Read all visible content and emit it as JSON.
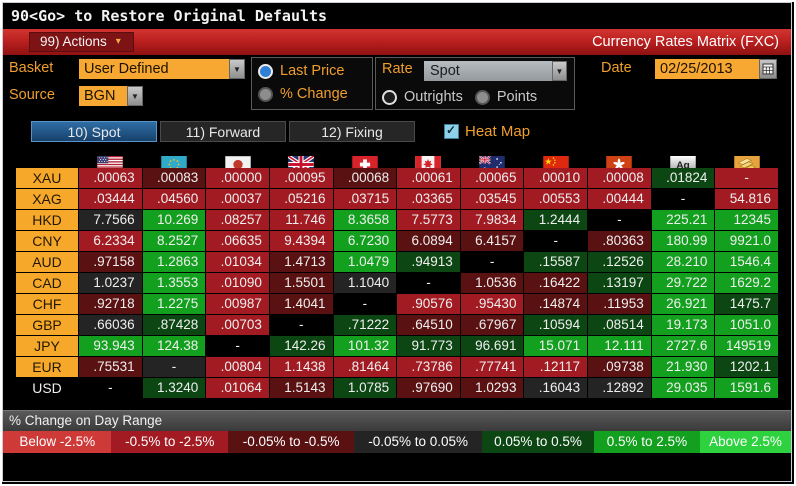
{
  "titlebar": {
    "text": "90<Go> to Restore Original Defaults"
  },
  "menubar": {
    "actions_label": "99) Actions",
    "actions_arrow_icon": "▾",
    "title": "Currency Rates Matrix (FXC)"
  },
  "controls": {
    "basket_label": "Basket",
    "basket_value": "User Defined",
    "source_label": "Source",
    "source_value": "BGN",
    "price_options": [
      {
        "label": "Last Price",
        "selected": true
      },
      {
        "label": "% Change",
        "selected": false
      }
    ],
    "rate_label": "Rate",
    "rate_value": "Spot",
    "outright_options": [
      {
        "label": "Outrights",
        "selected": true
      },
      {
        "label": "Points",
        "selected": false
      }
    ],
    "date_label": "Date",
    "date_value": "02/25/2013",
    "calendar_icon": "calendar-grid",
    "dropdown_arrow_icon": "▼"
  },
  "tabs": [
    {
      "label": "10) Spot",
      "selected": true
    },
    {
      "label": "11) Forward",
      "selected": false
    },
    {
      "label": "12) Fixing",
      "selected": false
    }
  ],
  "heatmap": {
    "label": "Heat Map",
    "checked": true
  },
  "heat_colors": {
    "bk": "#000000",
    "n": "#242424",
    "r": "#a21b22",
    "dr": "#5a1112",
    "dg": "#0c4613",
    "g": "#13a01e",
    "br": "#cd3a38",
    "bg": "#2ed13e"
  },
  "matrix": {
    "columns": [
      {
        "code": "USD",
        "flag": "us-flag"
      },
      {
        "code": "EUR",
        "flag": "eu-flag"
      },
      {
        "code": "JPY",
        "flag": "jp-flag"
      },
      {
        "code": "GBP",
        "flag": "uk-flag"
      },
      {
        "code": "CHF",
        "flag": "ch-flag"
      },
      {
        "code": "CAD",
        "flag": "ca-flag"
      },
      {
        "code": "AUD",
        "flag": "au-flag"
      },
      {
        "code": "CNY",
        "flag": "cn-flag"
      },
      {
        "code": "HKD",
        "flag": "hk-flag"
      },
      {
        "code": "XAG",
        "flag": "silver-icon"
      },
      {
        "code": "XAU",
        "flag": "gold-icon"
      }
    ],
    "rows": [
      {
        "label": "XAU",
        "label_style": "orange",
        "cells": [
          {
            "v": ".00063",
            "c": "r"
          },
          {
            "v": ".00083",
            "c": "dr"
          },
          {
            "v": ".00000",
            "c": "r"
          },
          {
            "v": ".00095",
            "c": "r"
          },
          {
            "v": ".00068",
            "c": "dr"
          },
          {
            "v": ".00061",
            "c": "r"
          },
          {
            "v": ".00065",
            "c": "r"
          },
          {
            "v": ".00010",
            "c": "r"
          },
          {
            "v": ".00008",
            "c": "r"
          },
          {
            "v": ".01824",
            "c": "dg"
          },
          {
            "v": "-",
            "c": "r"
          }
        ]
      },
      {
        "label": "XAG",
        "label_style": "orange",
        "cells": [
          {
            "v": ".03444",
            "c": "r"
          },
          {
            "v": ".04560",
            "c": "r"
          },
          {
            "v": ".00037",
            "c": "r"
          },
          {
            "v": ".05216",
            "c": "r"
          },
          {
            "v": ".03715",
            "c": "r"
          },
          {
            "v": ".03365",
            "c": "r"
          },
          {
            "v": ".03545",
            "c": "r"
          },
          {
            "v": ".00553",
            "c": "r"
          },
          {
            "v": ".00444",
            "c": "r"
          },
          {
            "v": "-",
            "c": "bk"
          },
          {
            "v": "54.816",
            "c": "r"
          }
        ]
      },
      {
        "label": "HKD",
        "label_style": "orange",
        "cells": [
          {
            "v": "7.7566",
            "c": "n"
          },
          {
            "v": "10.269",
            "c": "g"
          },
          {
            "v": ".08257",
            "c": "r"
          },
          {
            "v": "11.746",
            "c": "r"
          },
          {
            "v": "8.3658",
            "c": "g"
          },
          {
            "v": "7.5773",
            "c": "r"
          },
          {
            "v": "7.9834",
            "c": "r"
          },
          {
            "v": "1.2444",
            "c": "dg"
          },
          {
            "v": "-",
            "c": "bk"
          },
          {
            "v": "225.21",
            "c": "g"
          },
          {
            "v": "12345",
            "c": "g"
          }
        ]
      },
      {
        "label": "CNY",
        "label_style": "orange",
        "cells": [
          {
            "v": "6.2334",
            "c": "r"
          },
          {
            "v": "8.2527",
            "c": "g"
          },
          {
            "v": ".06635",
            "c": "r"
          },
          {
            "v": "9.4394",
            "c": "r"
          },
          {
            "v": "6.7230",
            "c": "g"
          },
          {
            "v": "6.0894",
            "c": "dr"
          },
          {
            "v": "6.4157",
            "c": "dr"
          },
          {
            "v": "-",
            "c": "bk"
          },
          {
            "v": ".80363",
            "c": "dr"
          },
          {
            "v": "180.99",
            "c": "g"
          },
          {
            "v": "9921.0",
            "c": "g"
          }
        ]
      },
      {
        "label": "AUD",
        "label_style": "orange",
        "cells": [
          {
            "v": ".97158",
            "c": "dr"
          },
          {
            "v": "1.2863",
            "c": "g"
          },
          {
            "v": ".01034",
            "c": "r"
          },
          {
            "v": "1.4713",
            "c": "dr"
          },
          {
            "v": "1.0479",
            "c": "g"
          },
          {
            "v": ".94913",
            "c": "dg"
          },
          {
            "v": "-",
            "c": "bk"
          },
          {
            "v": ".15587",
            "c": "dg"
          },
          {
            "v": ".12526",
            "c": "dg"
          },
          {
            "v": "28.210",
            "c": "g"
          },
          {
            "v": "1546.4",
            "c": "g"
          }
        ]
      },
      {
        "label": "CAD",
        "label_style": "orange",
        "cells": [
          {
            "v": "1.0237",
            "c": "n"
          },
          {
            "v": "1.3553",
            "c": "g"
          },
          {
            "v": ".01090",
            "c": "r"
          },
          {
            "v": "1.5501",
            "c": "dr"
          },
          {
            "v": "1.1040",
            "c": "n"
          },
          {
            "v": "-",
            "c": "bk"
          },
          {
            "v": "1.0536",
            "c": "dr"
          },
          {
            "v": ".16422",
            "c": "dr"
          },
          {
            "v": ".13197",
            "c": "dg"
          },
          {
            "v": "29.722",
            "c": "g"
          },
          {
            "v": "1629.2",
            "c": "g"
          }
        ]
      },
      {
        "label": "CHF",
        "label_style": "orange",
        "cells": [
          {
            "v": ".92718",
            "c": "dr"
          },
          {
            "v": "1.2275",
            "c": "g"
          },
          {
            "v": ".00987",
            "c": "r"
          },
          {
            "v": "1.4041",
            "c": "dr"
          },
          {
            "v": "-",
            "c": "bk"
          },
          {
            "v": ".90576",
            "c": "r"
          },
          {
            "v": ".95430",
            "c": "r"
          },
          {
            "v": ".14874",
            "c": "dr"
          },
          {
            "v": ".11953",
            "c": "dr"
          },
          {
            "v": "26.921",
            "c": "g"
          },
          {
            "v": "1475.7",
            "c": "dg"
          }
        ]
      },
      {
        "label": "GBP",
        "label_style": "orange",
        "cells": [
          {
            "v": ".66036",
            "c": "n"
          },
          {
            "v": ".87428",
            "c": "dg"
          },
          {
            "v": ".00703",
            "c": "r"
          },
          {
            "v": "-",
            "c": "bk"
          },
          {
            "v": ".71222",
            "c": "dg"
          },
          {
            "v": ".64510",
            "c": "dr"
          },
          {
            "v": ".67967",
            "c": "dr"
          },
          {
            "v": ".10594",
            "c": "dg"
          },
          {
            "v": ".08514",
            "c": "dg"
          },
          {
            "v": "19.173",
            "c": "g"
          },
          {
            "v": "1051.0",
            "c": "g"
          }
        ]
      },
      {
        "label": "JPY",
        "label_style": "orange",
        "cells": [
          {
            "v": "93.943",
            "c": "g"
          },
          {
            "v": "124.38",
            "c": "g"
          },
          {
            "v": "-",
            "c": "bk"
          },
          {
            "v": "142.26",
            "c": "dg"
          },
          {
            "v": "101.32",
            "c": "g"
          },
          {
            "v": "91.773",
            "c": "dg"
          },
          {
            "v": "96.691",
            "c": "dg"
          },
          {
            "v": "15.071",
            "c": "g"
          },
          {
            "v": "12.111",
            "c": "g"
          },
          {
            "v": "2727.6",
            "c": "g"
          },
          {
            "v": "149519",
            "c": "g"
          }
        ]
      },
      {
        "label": "EUR",
        "label_style": "orange",
        "cells": [
          {
            "v": ".75531",
            "c": "dr"
          },
          {
            "v": "-",
            "c": "n"
          },
          {
            "v": ".00804",
            "c": "r"
          },
          {
            "v": "1.1438",
            "c": "r"
          },
          {
            "v": ".81464",
            "c": "r"
          },
          {
            "v": ".73786",
            "c": "r"
          },
          {
            "v": ".77741",
            "c": "r"
          },
          {
            "v": ".12117",
            "c": "r"
          },
          {
            "v": ".09738",
            "c": "dr"
          },
          {
            "v": "21.930",
            "c": "g"
          },
          {
            "v": "1202.1",
            "c": "dg"
          }
        ]
      },
      {
        "label": "USD",
        "label_style": "plain",
        "cells": [
          {
            "v": "-",
            "c": "bk"
          },
          {
            "v": "1.3240",
            "c": "dg"
          },
          {
            "v": ".01064",
            "c": "r"
          },
          {
            "v": "1.5143",
            "c": "dr"
          },
          {
            "v": "1.0785",
            "c": "dg"
          },
          {
            "v": ".97690",
            "c": "dr"
          },
          {
            "v": "1.0293",
            "c": "dr"
          },
          {
            "v": ".16043",
            "c": "n"
          },
          {
            "v": ".12892",
            "c": "n"
          },
          {
            "v": "29.035",
            "c": "g"
          },
          {
            "v": "1591.6",
            "c": "g"
          }
        ]
      }
    ]
  },
  "legend": {
    "title": "% Change on Day Range",
    "buckets": [
      {
        "label": "Below -2.5%",
        "color_key": "br",
        "grow": 105
      },
      {
        "label": "-0.5% to -2.5%",
        "color_key": "r",
        "grow": 113
      },
      {
        "label": "-0.05% to -0.5%",
        "color_key": "dr",
        "grow": 122
      },
      {
        "label": "-0.05% to 0.05%",
        "color_key": "n",
        "grow": 124
      },
      {
        "label": "0.05% to 0.5%",
        "color_key": "dg",
        "grow": 108
      },
      {
        "label": "0.5% to 2.5%",
        "color_key": "g",
        "grow": 103
      },
      {
        "label": "Above 2.5%",
        "color_key": "bg",
        "grow": 88
      }
    ]
  }
}
